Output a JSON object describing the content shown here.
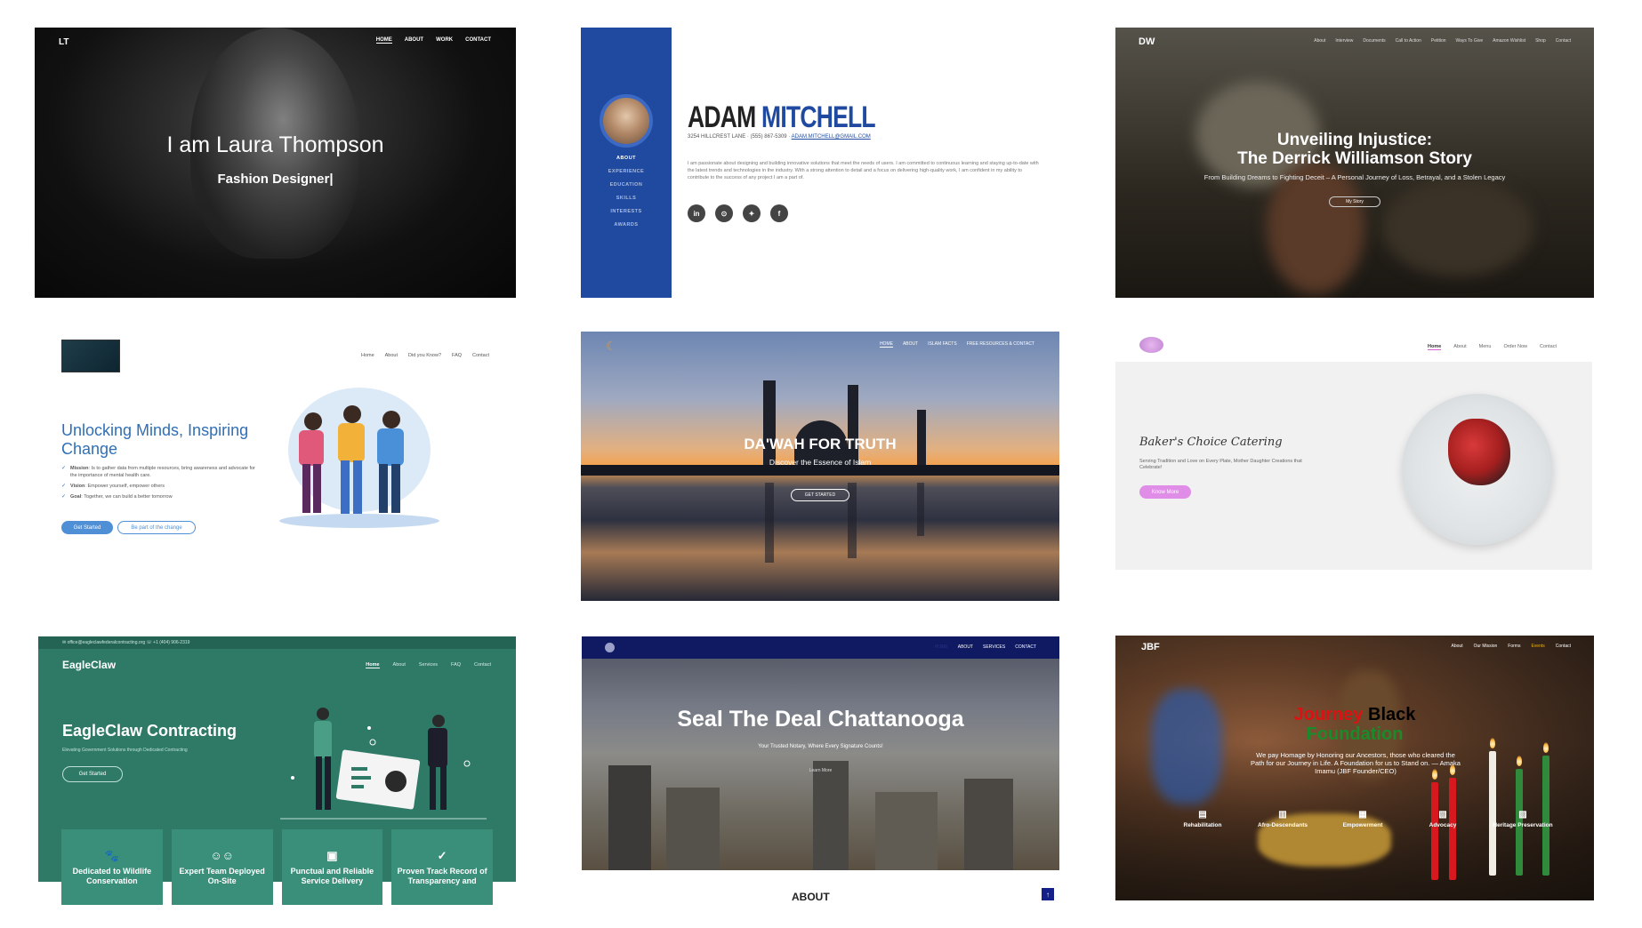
{
  "card1": {
    "logo": "LT",
    "nav": [
      "HOME",
      "ABOUT",
      "WORK",
      "CONTACT"
    ],
    "title": "I am Laura Thompson",
    "subtitle": "Fashion Designer|"
  },
  "card2": {
    "side_nav": [
      "ABOUT",
      "EXPERIENCE",
      "EDUCATION",
      "SKILLS",
      "INTERESTS",
      "AWARDS"
    ],
    "first_name": "ADAM",
    "last_name": "MITCHELL",
    "address": "3254 HILLCREST LANE · (555) 867-5309 ·",
    "email": "ADAM.MITCHELL@GMAIL.COM",
    "bio": "I am passionate about designing and building innovative solutions that meet the needs of users. I am committed to continuous learning and staying up-to-date with the latest trends and technologies in the industry. With a strong attention to detail and a focus on delivering high-quality work, I am confident in my ability to contribute to the success of any project I am a part of.",
    "socials": [
      "in",
      "gh",
      "tw",
      "f"
    ]
  },
  "card3": {
    "logo": "DW",
    "nav": [
      "About",
      "Interview",
      "Documents",
      "Call to Action",
      "Petition",
      "Ways To Give",
      "Amazon Wishlist",
      "Shop",
      "Contact"
    ],
    "title_line1": "Unveiling Injustice:",
    "title_line2": "The Derrick Williamson Story",
    "subtitle": "From Building Dreams to Fighting Deceit – A Personal Journey of Loss, Betrayal, and a Stolen Legacy",
    "button": "My Story"
  },
  "card4": {
    "nav": [
      "Home",
      "About",
      "Did you Know?",
      "FAQ",
      "Contact"
    ],
    "title": "Unlocking Minds, Inspiring Change",
    "mission_label": "Mission",
    "mission_text": ": Is to gather data from multiple resources, bring awareness and advocate for the importance of mental health care.",
    "vision_label": "Vision",
    "vision_text": ": Empower yourself, empower others",
    "goal_label": "Goal",
    "goal_text": ": Together, we can build a better tomorrow",
    "button_primary": "Get Started",
    "button_secondary": "Be part of the change"
  },
  "card5": {
    "nav": [
      "HOME",
      "ABOUT",
      "ISLAM FACTS",
      "FREE RESOURCES & CONTACT"
    ],
    "title": "DA'WAH FOR TRUTH",
    "subtitle": "Discover the Essence of Islam",
    "button": "GET STARTED"
  },
  "card6": {
    "nav": [
      "Home",
      "About",
      "Menu",
      "Order Now",
      "Contact"
    ],
    "title": "Baker's Choice Catering",
    "subtitle": "Serving Tradition and Love on Every Plate, Mother Daughter Creations that Celebrate!",
    "button": "Know More"
  },
  "card7": {
    "topbar": "✉ office@eagleclawfederalcontracting.org    ☏ +1 (404) 906-2319",
    "logo": "EagleClaw",
    "nav": [
      "Home",
      "About",
      "Services",
      "FAQ",
      "Contact"
    ],
    "title": "EagleClaw Contracting",
    "subtitle": "Elevating Government Solutions through Dedicated Contracting",
    "button": "Get Started",
    "features": [
      "Dedicated to Wildlife Conservation",
      "Expert Team Deployed On-Site",
      "Punctual and Reliable Service Delivery",
      "Proven Track Record of Transparency and"
    ]
  },
  "card8": {
    "nav": [
      "HOME",
      "ABOUT",
      "SERVICES",
      "CONTACT"
    ],
    "title": "Seal The Deal Chattanooga",
    "subtitle": "Your Trusted Notary, Where Every Signature Counts!",
    "link": "Learn More",
    "section_heading": "ABOUT"
  },
  "card9": {
    "logo": "JBF",
    "nav": [
      "About",
      "Our Mission",
      "Forms",
      "Events",
      "Contact"
    ],
    "title_journey": "Journey",
    "title_black": "Black",
    "title_foundation": "Foundation",
    "text": "We pay Homage by Honoring our Ancestors, those who cleared the Path for our Journey in Life. A Foundation for us to Stand on. — Amaka Imamu (JBF Founder/CEO)",
    "pillars": [
      "Rehabilitation",
      "Afro-Descendants",
      "Empowerment",
      "Advocacy",
      "Heritage Preservation"
    ]
  },
  "colors": {
    "adam_blue": "#1f4aa0",
    "eagleclaw_green": "#2e7a66",
    "bakers_pink": "#e08de8",
    "seal_navy": "#0f1a63",
    "jbf_red": "#dd1111",
    "jbf_green": "#1a8a2a"
  }
}
